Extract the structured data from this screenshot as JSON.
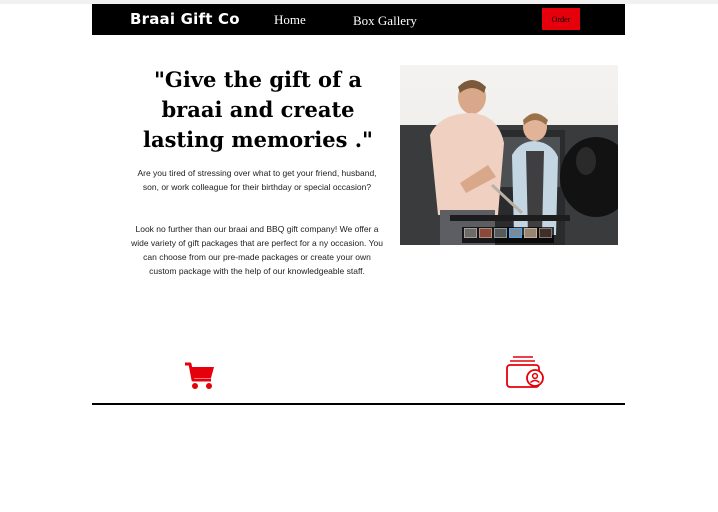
{
  "nav": {
    "brand": "Braai Gift Co",
    "links": [
      {
        "label": "Home"
      },
      {
        "label": "Box Gallery"
      }
    ],
    "order_label": "Order"
  },
  "hero": {
    "headline": "\"Give the gift of a braai and create lasting memories .\"",
    "paragraph1": "Are you tired of stressing over what to get your friend, husband, son, or work colleague for their birthday or special occasion?",
    "paragraph2": "Look no further than our braai and BBQ gift company! We offer a wide variety of gift packages that are perfect for a ny occasion. You can choose from our pre-made packages or create your own custom package with the help of our knowledgeable staff.",
    "gallery_thumbnail_count": 6,
    "gallery_selected_index": 3
  },
  "icons": {
    "cart": "shopping-cart-icon",
    "wallet": "wallet-user-icon"
  },
  "colors": {
    "accent": "#e5000b",
    "nav_background": "#000000",
    "text": "#000000"
  }
}
